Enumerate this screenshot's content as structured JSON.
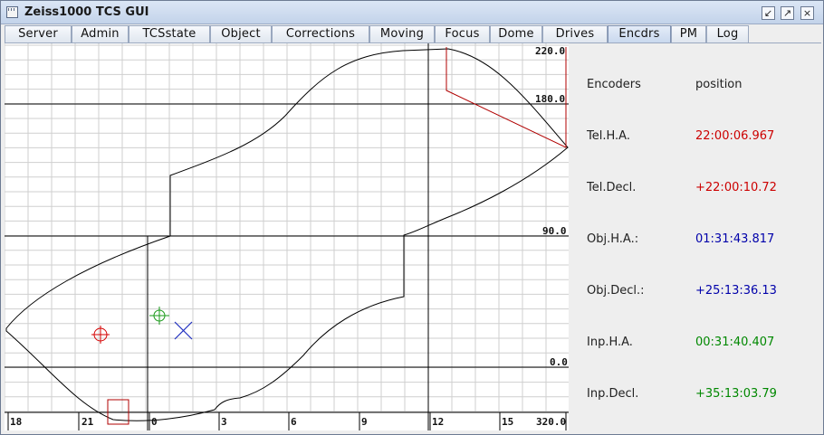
{
  "window": {
    "title": "Zeiss1000 TCS GUI",
    "buttons": [
      "↙",
      "↗",
      "×"
    ]
  },
  "tabs": [
    {
      "label": "Server"
    },
    {
      "label": "Admin"
    },
    {
      "label": "TCSstate"
    },
    {
      "label": "Object"
    },
    {
      "label": "Corrections"
    },
    {
      "label": "Moving"
    },
    {
      "label": "Focus"
    },
    {
      "label": "Dome"
    },
    {
      "label": "Drives"
    },
    {
      "label": "Encdrs",
      "active": true
    },
    {
      "label": "PM"
    },
    {
      "label": "Log"
    }
  ],
  "plot": {
    "y_labels": [
      "220.0",
      "180.0",
      "90.0",
      "0.0"
    ],
    "x_labels": [
      "18",
      "21",
      "0",
      "3",
      "6",
      "9",
      "12",
      "15",
      "320.0"
    ],
    "markers": [
      {
        "kind": "telescope-crosshair",
        "color": "#d40000"
      },
      {
        "kind": "object-crosshair",
        "color": "#1a9a1a"
      },
      {
        "kind": "input-cross",
        "color": "#2030c0"
      }
    ]
  },
  "encoders": {
    "header_name": "Encoders",
    "header_position": "position",
    "rows": [
      {
        "label": "Tel.H.A.",
        "value": "22:00:06.967",
        "color": "#cc0000"
      },
      {
        "label": "Tel.Decl.",
        "value": "+22:00:10.72",
        "color": "#cc0000"
      },
      {
        "label": "Obj.H.A.:",
        "value": "01:31:43.817",
        "color": "#0000aa"
      },
      {
        "label": "Obj.Decl.:",
        "value": "+25:13:36.13",
        "color": "#0000aa"
      },
      {
        "label": "Inp.H.A.",
        "value": "00:31:40.407",
        "color": "#008800"
      },
      {
        "label": "Inp.Decl.",
        "value": "+35:13:03.79",
        "color": "#008800"
      }
    ]
  }
}
